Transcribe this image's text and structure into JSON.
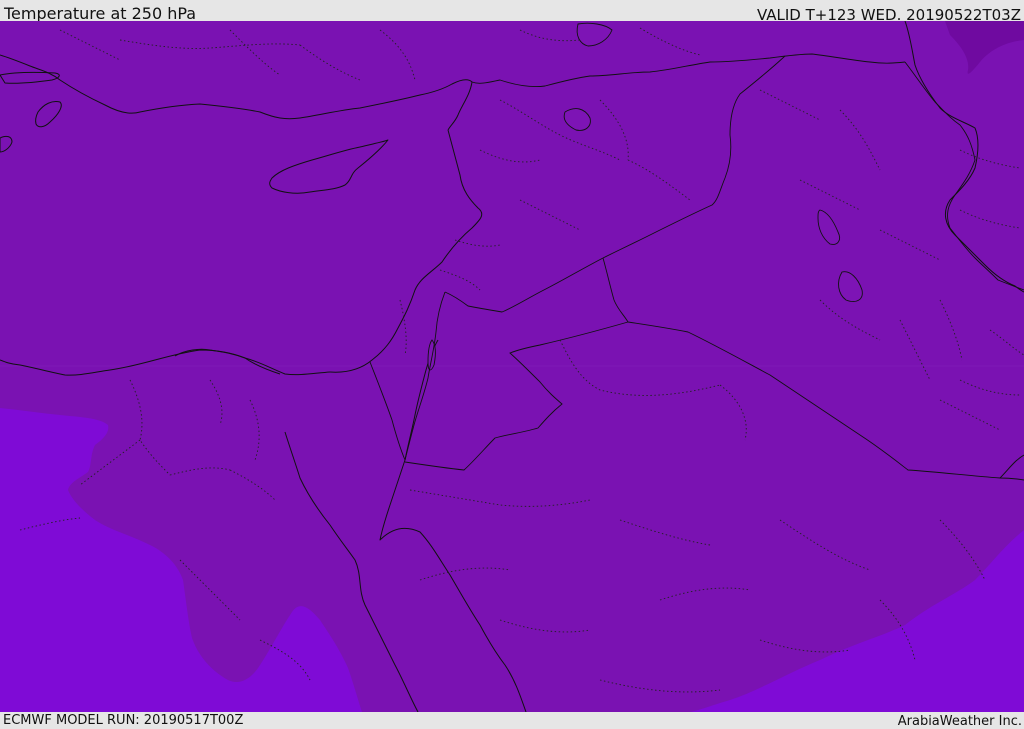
{
  "header": {
    "title": "Temperature at 250 hPa",
    "valid": "VALID T+123 WED. 20190522T03Z"
  },
  "footer": {
    "model_run": "ECMWF MODEL RUN: 20190517T00Z",
    "credit": "ArabiaWeather Inc."
  },
  "colors": {
    "band_main": "#7a12b2",
    "band_warm": "#7f0bd6",
    "band_cold": "#6f0aa0",
    "coast_line": "#111111"
  }
}
